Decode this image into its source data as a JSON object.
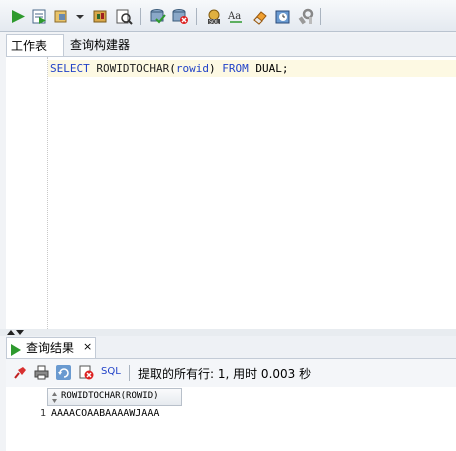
{
  "worksheet_tabs": {
    "worksheet": "工作表",
    "query_builder": "查询构建器"
  },
  "editor": {
    "sql_kw_select": "SELECT",
    "sql_fn": "ROWIDTOCHAR",
    "sql_open": "(",
    "sql_param": "rowid",
    "sql_close": ")",
    "sql_kw_from": "FROM",
    "sql_table": "DUAL;"
  },
  "results": {
    "tab_label": "查询结果",
    "close_glyph": "×",
    "sql_label": "SQL",
    "status": "提取的所有行: 1, 用时 0.003 秒",
    "column_header": "ROWIDTOCHAR(ROWID)",
    "rows": [
      {
        "num": "1",
        "value": "AAAACOAABAAAAWJAAA"
      }
    ]
  },
  "colors": {
    "keyword_blue": "#2142c8",
    "run_green": "#2e9a2e",
    "current_line": "#fdf9e3"
  },
  "icons": [
    "run-statement-icon",
    "run-script-icon",
    "commit-icon",
    "rollback-icon",
    "autotrace-icon",
    "sql-tuning-icon",
    "clear-icon",
    "unshared-sql-icon",
    "uppercase-icon",
    "eraser-icon",
    "history-icon",
    "tools-icon",
    "pin-icon",
    "print-icon",
    "refresh-icon",
    "delete-icon"
  ]
}
